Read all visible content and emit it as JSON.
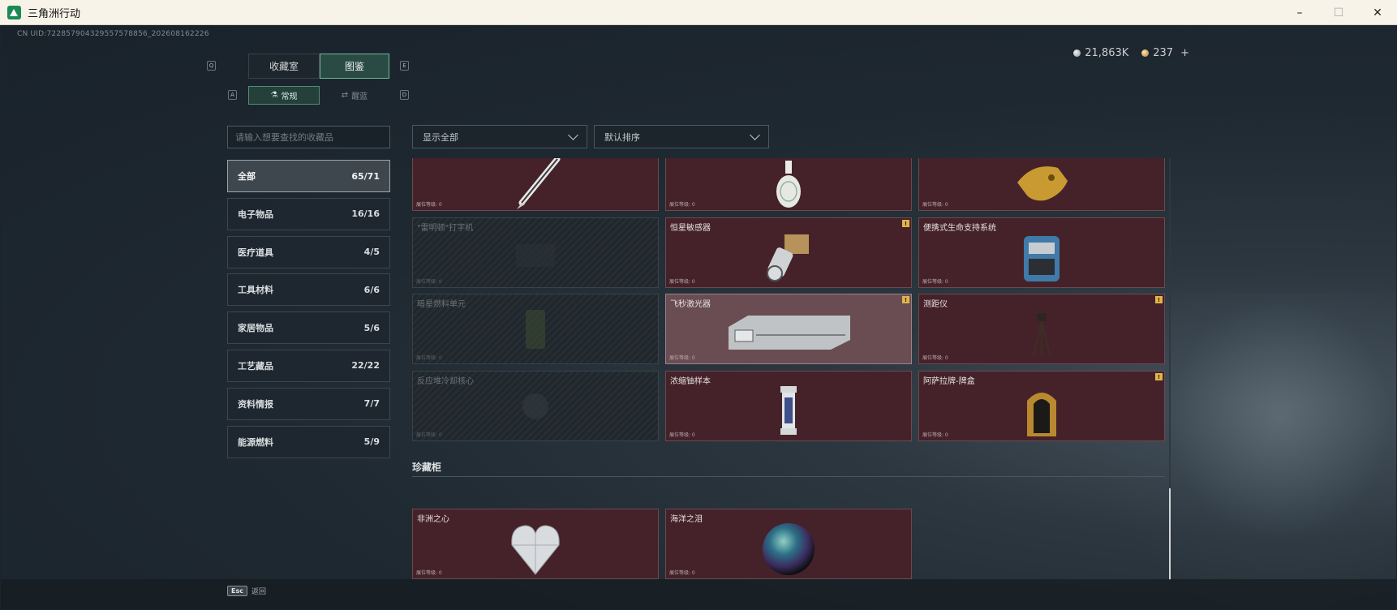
{
  "window": {
    "title": "三角洲行动",
    "controls": [
      "–",
      "☐",
      "✕"
    ]
  },
  "uid": "CN UID:722857904329557578856_202608162226",
  "currency": [
    {
      "icon": "silver-coin-icon",
      "value": "21,863K"
    },
    {
      "icon": "gold-coin-icon",
      "value": "237"
    }
  ],
  "currency_plus": "+",
  "tabs": {
    "key_left": "Q",
    "key_right": "E",
    "items": [
      {
        "label": "收藏室",
        "active": false
      },
      {
        "label": "图鉴",
        "active": true
      }
    ]
  },
  "subtabs": {
    "key_left": "A",
    "key_right": "D",
    "items": [
      {
        "label": "常规",
        "active": true
      },
      {
        "label": "醒蓝",
        "active": false
      }
    ]
  },
  "search": {
    "placeholder": "请输入想要查找的收藏品"
  },
  "categories": [
    {
      "label": "全部",
      "count": "65/71",
      "active": true
    },
    {
      "label": "电子物品",
      "count": "16/16",
      "active": false
    },
    {
      "label": "医疗道具",
      "count": "4/5",
      "active": false
    },
    {
      "label": "工具材料",
      "count": "6/6",
      "active": false
    },
    {
      "label": "家居物品",
      "count": "5/6",
      "active": false
    },
    {
      "label": "工艺藏品",
      "count": "22/22",
      "active": false
    },
    {
      "label": "资料情报",
      "count": "7/7",
      "active": false
    },
    {
      "label": "能源燃料",
      "count": "5/9",
      "active": false
    }
  ],
  "filters": {
    "display": "显示全部",
    "sort": "默认排序"
  },
  "level_label": "展位等级: 0",
  "grid_items": [
    {
      "name": "",
      "locked": false,
      "badge": false,
      "icon": "fountain-pen-icon"
    },
    {
      "name": "",
      "locked": false,
      "badge": false,
      "icon": "porcelain-vase-icon"
    },
    {
      "name": "",
      "locked": false,
      "badge": false,
      "icon": "golden-horse-head-icon"
    },
    {
      "name": "\"雷明顿\"打字机",
      "locked": true,
      "badge": false,
      "icon": "typewriter-icon"
    },
    {
      "name": "恒星敏感器",
      "locked": false,
      "badge": true,
      "icon": "star-sensor-icon"
    },
    {
      "name": "便携式生命支持系统",
      "locked": false,
      "badge": false,
      "icon": "life-support-icon"
    },
    {
      "name": "暗星燃料单元",
      "locked": true,
      "badge": false,
      "icon": "fuel-cell-icon"
    },
    {
      "name": "飞秒激光器",
      "locked": false,
      "badge": true,
      "selected": true,
      "icon": "femtosecond-laser-icon"
    },
    {
      "name": "测距仪",
      "locked": false,
      "badge": true,
      "icon": "tripod-rangefinder-icon"
    },
    {
      "name": "反应堆冷却核心",
      "locked": true,
      "badge": false,
      "icon": "reactor-core-icon"
    },
    {
      "name": "浓缩铀样本",
      "locked": false,
      "badge": false,
      "icon": "uranium-sample-icon"
    },
    {
      "name": "阿萨拉牌-牌盒",
      "locked": false,
      "badge": true,
      "icon": "card-box-icon"
    }
  ],
  "treasure_section": {
    "title": "珍藏柜",
    "items": [
      {
        "name": "非洲之心",
        "icon": "heart-diamond-icon"
      },
      {
        "name": "海洋之泪",
        "icon": "ocean-tear-orb-icon"
      }
    ]
  },
  "badge_symbol": "!",
  "footer": {
    "key": "Esc",
    "label": "返回"
  }
}
